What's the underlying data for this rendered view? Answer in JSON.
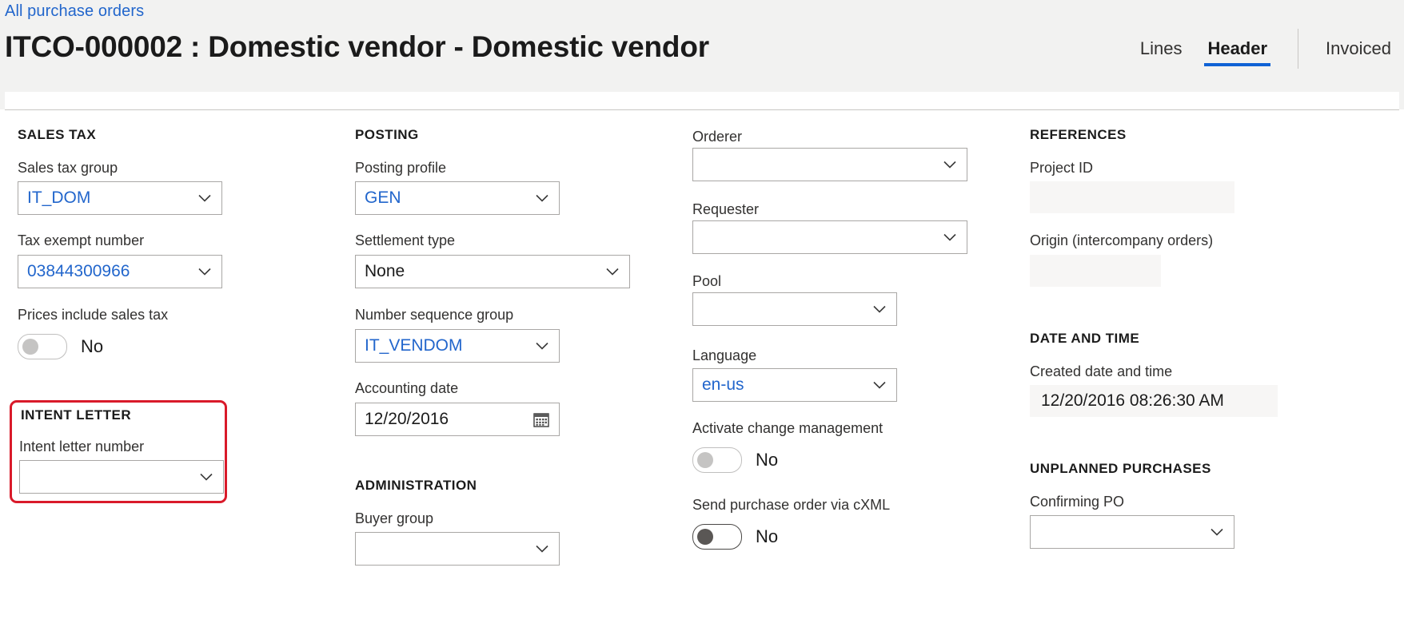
{
  "header": {
    "breadcrumb": "All purchase orders",
    "title": "ITCO-000002 : Domestic vendor - Domestic vendor",
    "tabs": [
      {
        "label": "Lines",
        "selected": false
      },
      {
        "label": "Header",
        "selected": true
      }
    ],
    "status": "Invoiced"
  },
  "sales_tax": {
    "section": "SALES TAX",
    "sales_tax_group": {
      "label": "Sales tax group",
      "value": "IT_DOM"
    },
    "tax_exempt_number": {
      "label": "Tax exempt number",
      "value": "03844300966"
    },
    "prices_include_sales_tax": {
      "label": "Prices include sales tax",
      "value": "No"
    }
  },
  "intent_letter": {
    "section": "INTENT LETTER",
    "intent_letter_number": {
      "label": "Intent letter number",
      "value": ""
    },
    "highlight_color": "#d91a2a"
  },
  "posting": {
    "section": "POSTING",
    "posting_profile": {
      "label": "Posting profile",
      "value": "GEN"
    },
    "settlement_type": {
      "label": "Settlement type",
      "value": "None"
    },
    "number_sequence_group": {
      "label": "Number sequence group",
      "value": "IT_VENDOM"
    },
    "accounting_date": {
      "label": "Accounting date",
      "value": "12/20/2016"
    }
  },
  "administration": {
    "section": "ADMINISTRATION",
    "buyer_group": {
      "label": "Buyer group",
      "value": ""
    }
  },
  "people": {
    "orderer": {
      "label": "Orderer",
      "value": ""
    },
    "requester": {
      "label": "Requester",
      "value": ""
    },
    "pool": {
      "label": "Pool",
      "value": ""
    },
    "language": {
      "label": "Language",
      "value": "en-us"
    },
    "activate_change_management": {
      "label": "Activate change management",
      "value": "No"
    },
    "send_po_via_cxml": {
      "label": "Send purchase order via cXML",
      "value": "No"
    }
  },
  "references": {
    "section": "REFERENCES",
    "project_id": {
      "label": "Project ID",
      "value": ""
    },
    "origin": {
      "label": "Origin (intercompany orders)",
      "value": ""
    }
  },
  "date_and_time": {
    "section": "DATE AND TIME",
    "created_date_and_time": {
      "label": "Created date and time",
      "value": "12/20/2016 08:26:30 AM"
    }
  },
  "unplanned_purchases": {
    "section": "UNPLANNED PURCHASES",
    "confirming_po": {
      "label": "Confirming PO",
      "value": ""
    }
  },
  "colors": {
    "link": "#2266cc",
    "accent": "#0f62d5",
    "header_bg": "#f2f2f1",
    "highlight": "#d91a2a",
    "readonly_bg": "#f7f6f5"
  }
}
